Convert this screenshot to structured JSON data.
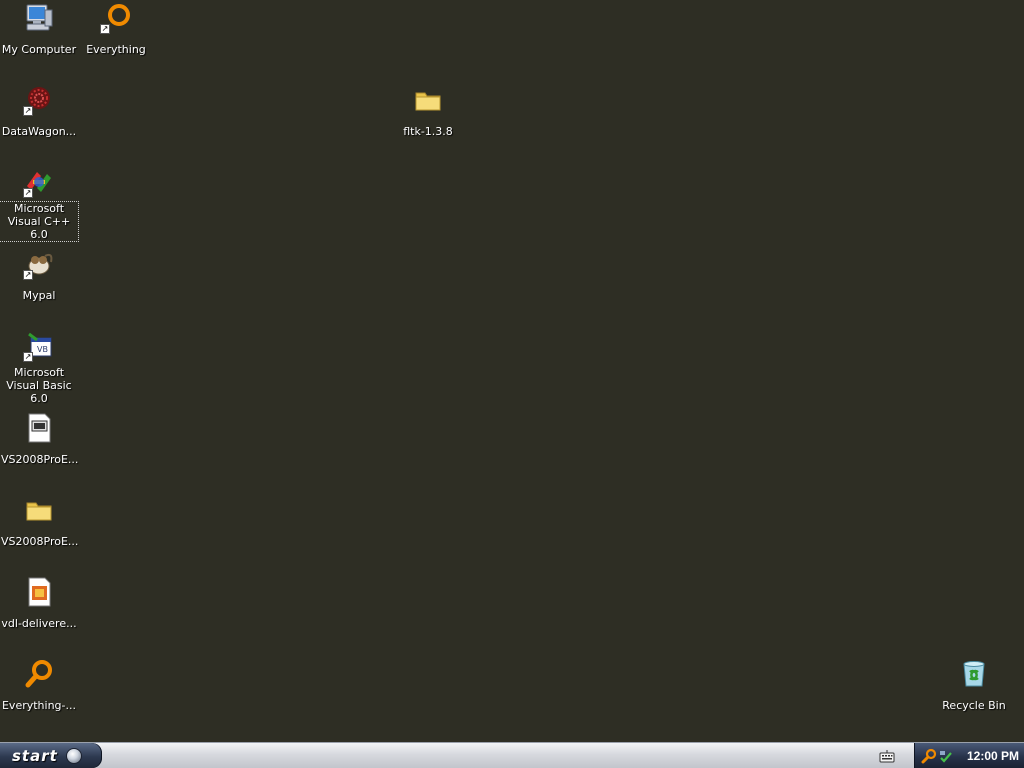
{
  "desktop": {
    "background_color": "#2e2e24",
    "icons": {
      "my_computer": "My Computer",
      "everything": "Everything",
      "datawagon": "DataWagon...",
      "fltk": "fltk-1.3.8",
      "vc6": "Microsoft Visual C++ 6.0",
      "mypal": "Mypal",
      "vb6": "Microsoft Visual Basic 6.0",
      "vs2008_file": "VS2008ProE...",
      "vs2008_folder": "VS2008ProE...",
      "vdl": "vdl-delivere...",
      "everything_setup": "Everything-...",
      "recycle_bin": "Recycle Bin"
    }
  },
  "taskbar": {
    "start_label": "start",
    "clock": "12:00 PM"
  }
}
